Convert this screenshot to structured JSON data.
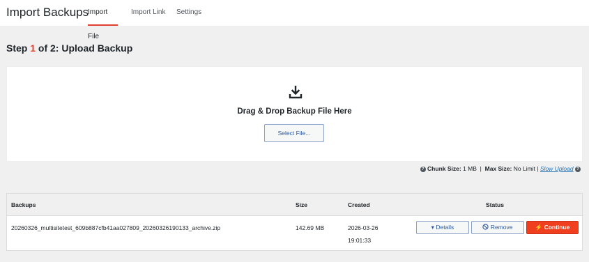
{
  "header": {
    "title": "Import Backups",
    "tabs": [
      {
        "label": "Import File",
        "active": true
      },
      {
        "label": "Import Link",
        "active": false
      },
      {
        "label": "Settings",
        "active": false
      }
    ]
  },
  "step": {
    "prefix": "Step ",
    "number": "1",
    "suffix": " of 2: Upload Backup"
  },
  "dropzone": {
    "icon": "download-icon",
    "text": "Drag & Drop Backup File Here",
    "button": "Select File..."
  },
  "upload_info": {
    "chunk_label": "Chunk Size:",
    "chunk_value": "1 MB",
    "sep": "|",
    "max_label": "Max Size:",
    "max_value": "No Limit",
    "sep2": "|",
    "slow_link": "Slow Upload"
  },
  "table": {
    "columns": [
      "Backups",
      "Size",
      "Created",
      "Status"
    ],
    "rows": [
      {
        "name": "20260326_multisitetest_609b887cfb41aa027809_20260326190133_archive.zip",
        "size": "142.69 MB",
        "created_date": "2026-03-26",
        "created_time": "19:01:33",
        "actions": {
          "details": "Details",
          "remove": "Remove",
          "continue": "Continue"
        }
      }
    ]
  },
  "colors": {
    "accent": "#e2402f",
    "link": "#2271b1",
    "continue": "#f03f1e"
  }
}
